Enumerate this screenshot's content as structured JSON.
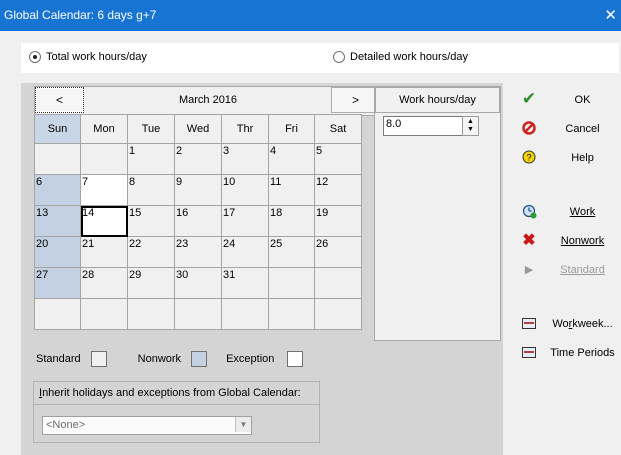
{
  "window": {
    "title": "Global Calendar: 6 days g+7"
  },
  "radio": {
    "total_label": "Total work hours/day",
    "detailed_label": "Detailed work hours/day"
  },
  "calendar": {
    "prev_label": "<",
    "next_label": ">",
    "month_label": "March 2016",
    "weekdays": [
      "Sun",
      "Mon",
      "Tue",
      "Wed",
      "Thr",
      "Fri",
      "Sat"
    ],
    "weeks": [
      [
        "",
        "",
        "1",
        "2",
        "3",
        "4",
        "5"
      ],
      [
        "6",
        "7",
        "8",
        "9",
        "10",
        "11",
        "12"
      ],
      [
        "13",
        "14",
        "15",
        "16",
        "17",
        "18",
        "19"
      ],
      [
        "20",
        "21",
        "22",
        "23",
        "24",
        "25",
        "26"
      ],
      [
        "27",
        "28",
        "29",
        "30",
        "31",
        "",
        ""
      ],
      [
        "",
        "",
        "",
        "",
        "",
        "",
        ""
      ]
    ]
  },
  "hours": {
    "title": "Work hours/day",
    "value": "8.0"
  },
  "legend": {
    "standard": "Standard",
    "nonwork": "Nonwork",
    "exception": "Exception",
    "colors": {
      "standard": "#f0f0f0",
      "nonwork": "#c3d1e2",
      "exception": "#ffffff"
    }
  },
  "inherit": {
    "title_first": "I",
    "title_rest": "nherit holidays and exceptions from Global Calendar:",
    "select_value": "<None>"
  },
  "buttons": {
    "ok": "OK",
    "cancel": "Cancel",
    "help": "Help",
    "work": "Work",
    "nonwork": "Nonwork",
    "standard": "Standard",
    "workweek_pre": "Wo",
    "workweek_u": "r",
    "workweek_post": "kweek...",
    "time_periods": "Time Periods"
  }
}
